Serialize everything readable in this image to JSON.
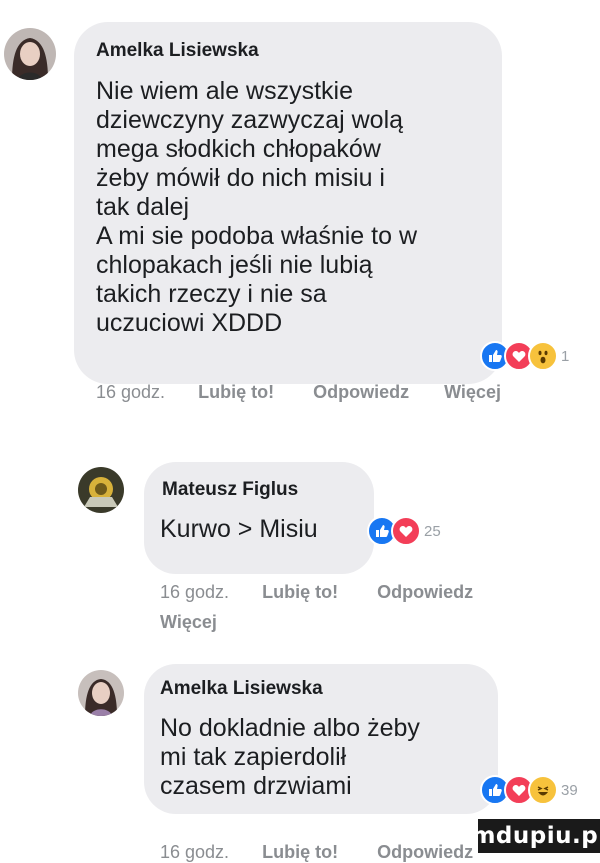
{
  "comments": [
    {
      "author": "Amelka Lisiewska",
      "text": "Nie wiem ale wszystkie\ndziewczyny zazwyczaj wolą\nmega słodkich chłopaków\nżeby mówił do nich misiu i\ntak dalej\nA mi sie podoba właśnie to w\nchlopakach jeśli nie lubią\ntakich rzeczy i nie sa\nuczuciowi XDDD",
      "reactions": [
        "like-icon",
        "love-icon",
        "wow-icon"
      ],
      "reaction_count": "1",
      "time": "16 godz.",
      "like": "Lubię to!",
      "reply": "Odpowiedz",
      "more": "Więcej"
    },
    {
      "author": "Mateusz Figlus",
      "text": "Kurwo > Misiu",
      "reactions": [
        "like-icon",
        "love-icon"
      ],
      "reaction_count": "25",
      "time": "16 godz.",
      "like": "Lubię to!",
      "reply": "Odpowiedz",
      "more": "Więcej"
    },
    {
      "author": "Amelka Lisiewska",
      "text": "No dokladnie albo żeby\nmi tak zapierdolił\nczasem drzwiami",
      "reactions": [
        "like-icon",
        "love-icon",
        "haha-icon"
      ],
      "reaction_count": "39",
      "time": "16 godz.",
      "like": "Lubię to!",
      "reply": "Odpowiedz"
    }
  ],
  "watermark": "mdupiu.pl",
  "colors": {
    "bubble": "#ececef",
    "like": "#1877f2",
    "love": "#f33e58",
    "wow": "#f7c23c",
    "meta_text": "#8a8d91"
  }
}
